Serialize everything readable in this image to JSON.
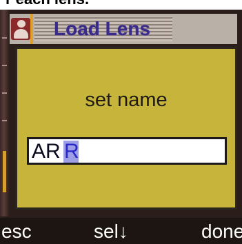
{
  "caption": {
    "text": "r each lens."
  },
  "title_bar": {
    "title": "Load Lens",
    "icon": "user-icon"
  },
  "dialog": {
    "label": "set name",
    "name_field": {
      "value": "AR",
      "cursor_char": "R"
    }
  },
  "softkeys": {
    "left": "esc",
    "center": "sel↓",
    "right": "done"
  },
  "colors": {
    "dialog_bg": "#c7b43a",
    "title_text": "#3a2a8a",
    "cursor_highlight": "#9c9fe6",
    "softkey_bar": "#1c1511"
  }
}
